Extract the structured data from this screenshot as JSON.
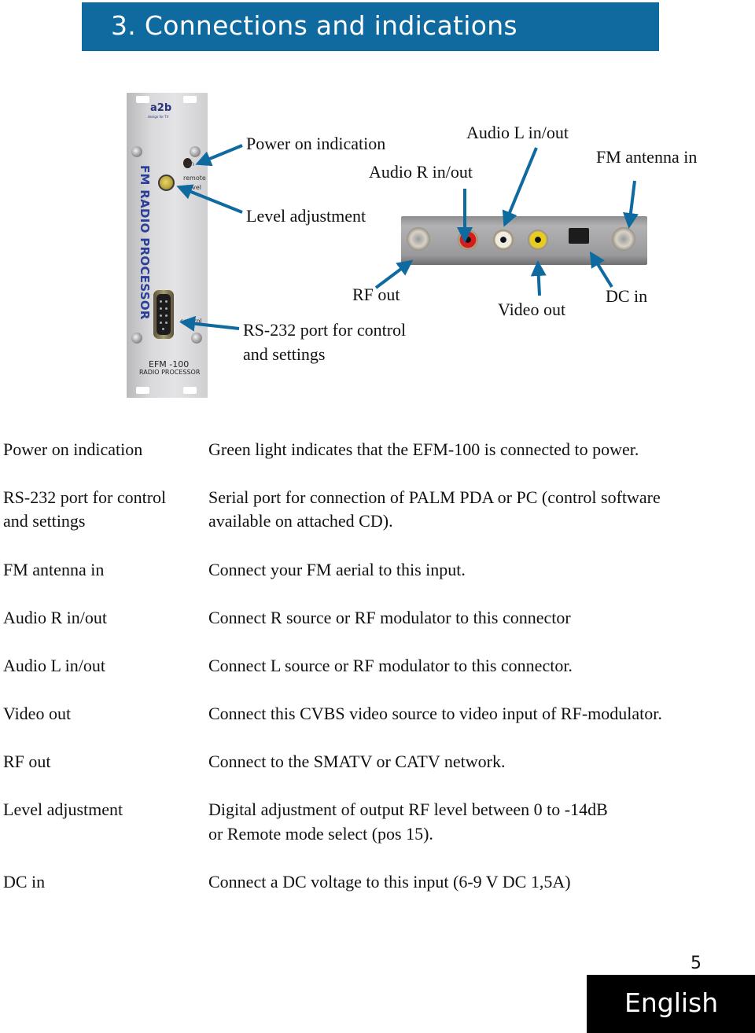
{
  "header": {
    "title": "3. Connections and indications",
    "bar_color": "#0f6aa0"
  },
  "device": {
    "front_panel": {
      "logo": "a2b",
      "logo_tagline": "design for TV",
      "vertical_title": "FM RADIO PROCESSOR",
      "led_label": "on",
      "knob_labels": [
        "remote",
        "level"
      ],
      "port_label": "control",
      "model": "EFM -100",
      "model_subtitle": "RADIO PROCESSOR"
    },
    "rear_connectors": [
      {
        "name": "RF out",
        "type": "F-connector"
      },
      {
        "name": "Audio R in/out",
        "type": "RCA",
        "color": "#d81b1b"
      },
      {
        "name": "Audio L in/out",
        "type": "RCA",
        "color": "#efece4"
      },
      {
        "name": "Video out",
        "type": "RCA",
        "color": "#e8cd1e"
      },
      {
        "name": "DC in",
        "type": "DC jack"
      },
      {
        "name": "FM antenna in",
        "type": "F-connector"
      }
    ],
    "arrow_color": "#0f6aa0"
  },
  "callouts": {
    "power_on": "Power on indication",
    "level_adjustment": "Level adjustment",
    "rs232_line1": "RS-232 port for control",
    "rs232_line2": "and settings",
    "audio_l": "Audio L in/out",
    "audio_r": "Audio R in/out",
    "fm_antenna": "FM antenna in",
    "rf_out": "RF out",
    "video_out": "Video out",
    "dc_in": "DC in"
  },
  "table": [
    {
      "label": "Power on indication",
      "description": [
        "Green light indicates that the EFM-100 is connected to power."
      ]
    },
    {
      "label": [
        "RS-232 port for control",
        "and settings"
      ],
      "description": [
        "Serial port for connection of PALM PDA or PC (control software",
        "available on attached CD)."
      ]
    },
    {
      "label": "FM antenna in",
      "description": [
        "Connect your FM aerial to this input."
      ]
    },
    {
      "label": "Audio R in/out",
      "description": [
        "Connect R source or RF modulator to this connector"
      ]
    },
    {
      "label": "Audio L in/out",
      "description": [
        "Connect L source or RF modulator to this connector."
      ]
    },
    {
      "label": "Video out",
      "description": [
        "Connect this CVBS video source to video input of RF-modulator."
      ]
    },
    {
      "label": "RF out",
      "description": [
        "Connect to the SMATV or CATV network."
      ]
    },
    {
      "label": "Level adjustment",
      "description": [
        "Digital adjustment of output RF level between 0 to -14dB",
        "or Remote mode select (pos 15)."
      ]
    },
    {
      "label": "DC in",
      "description": [
        "Connect a DC voltage to this input (6-9 V DC 1,5A)"
      ]
    }
  ],
  "footer": {
    "page_number": "5",
    "language": "English"
  }
}
